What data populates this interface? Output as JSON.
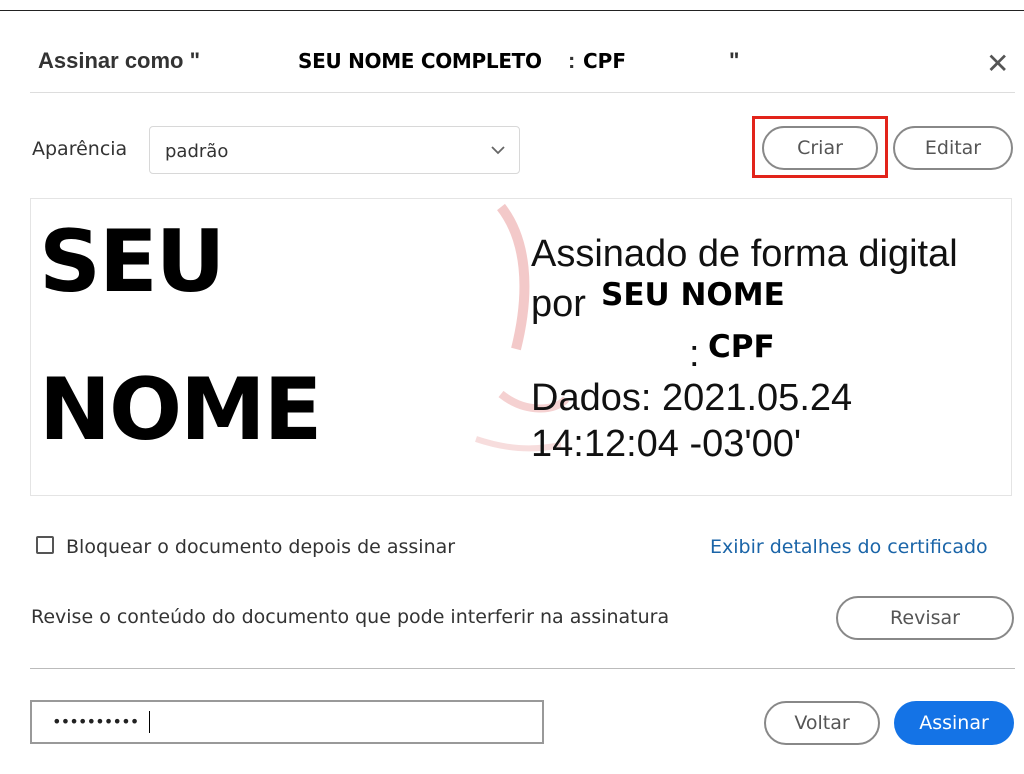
{
  "dialog": {
    "title_prefix": "Assinar como \"",
    "title_name": "SEU NOME COMPLETO",
    "title_sep": ":",
    "title_cpf": "CPF",
    "title_suffix": "\"",
    "close_icon": "close-icon"
  },
  "appearance": {
    "label": "Aparência",
    "selected": "padrão",
    "create_label": "Criar",
    "edit_label": "Editar"
  },
  "preview": {
    "big_line1": "SEU",
    "big_line2": "NOME",
    "line1": "Assinado de forma digital",
    "line2_prefix": "por",
    "line2_name": "SEU NOME",
    "line3_sep": ":",
    "line3_cpf": "CPF",
    "line4": "Dados: 2021.05.24",
    "line5": "14:12:04 -03'00'"
  },
  "options": {
    "lock_label": "Bloquear o documento depois de assinar",
    "lock_checked": false,
    "cert_link": "Exibir detalhes do certificado"
  },
  "review": {
    "text": "Revise o conteúdo do documento que pode interferir na assinatura",
    "button": "Revisar"
  },
  "footer": {
    "password_value": "••••••••••",
    "back_label": "Voltar",
    "sign_label": "Assinar",
    "accent": "#1473e6",
    "highlight": "#e2231a"
  }
}
